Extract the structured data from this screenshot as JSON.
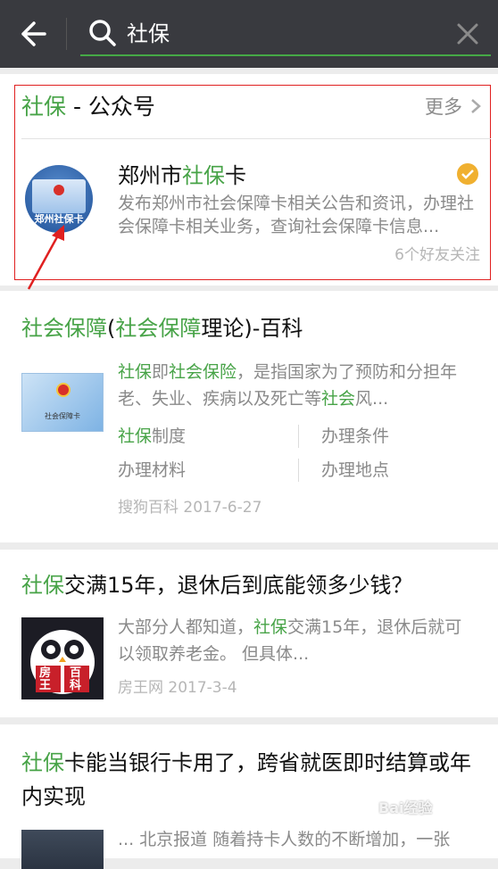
{
  "search": {
    "query": "社保"
  },
  "section": {
    "title_hl": "社保",
    "title_rest": " - 公众号",
    "more": "更多"
  },
  "account": {
    "name_pre": "郑州市",
    "name_hl": "社保",
    "name_post": "卡",
    "avatar_text": "郑州社保卡",
    "desc": "发布郑州市社会保障卡相关公告和资讯，办理社会保障卡相关业务，查询社会保障卡信息...",
    "followers": "6个好友关注"
  },
  "article1": {
    "title_hl1": "社会保障",
    "title_p1": "(",
    "title_hl2": "社会保障",
    "title_p2": "理论)-百科",
    "body_hl1": "社保",
    "body_t1": "即",
    "body_hl2": "社会保险",
    "body_t2": "，是指国家为了预防和分担年老、失业、疾病以及死亡等",
    "body_hl3": "社会",
    "body_t3": "风...",
    "links": {
      "l1_hl": "社保",
      "l1_rest": "制度",
      "l2": "办理条件",
      "l3": "办理材料",
      "l4": "办理地点"
    },
    "source": "搜狗百科  2017-6-27",
    "thumb_caption": "社会保障卡"
  },
  "article2": {
    "title_hl": "社保",
    "title_rest": "交满15年，退休后到底能领多少钱？",
    "body_t1": "大部分人都知道，",
    "body_hl": "社保",
    "body_t2": "交满15年，退休后就可以领取养老金。 但具体...",
    "source": "房王网  2017-3-4",
    "thumb_text": [
      "房",
      "王",
      "百",
      "科"
    ]
  },
  "article3": {
    "title_hl": "社保",
    "title_rest": "卡能当银行卡用了，跨省就医即时结算或年内实现",
    "body": "... 北京报道 随着持卡人数的不断增加，一张"
  },
  "watermark": "Bai经验",
  "colors": {
    "accent": "#47a347",
    "topbar": "#393a3f",
    "annotation": "#e02020"
  }
}
